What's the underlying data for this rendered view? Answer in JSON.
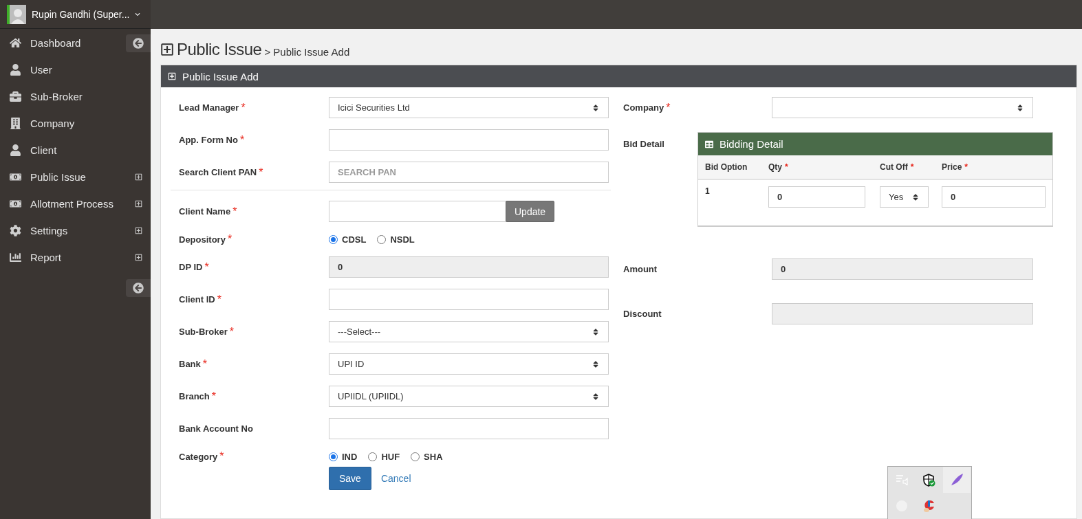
{
  "user": {
    "name": "Rupin Gandhi (Super..."
  },
  "sidebar": {
    "items": [
      {
        "label": "Dashboard",
        "expandable": false
      },
      {
        "label": "User",
        "expandable": false
      },
      {
        "label": "Sub-Broker",
        "expandable": false
      },
      {
        "label": "Company",
        "expandable": false
      },
      {
        "label": "Client",
        "expandable": false
      },
      {
        "label": "Public Issue",
        "expandable": true
      },
      {
        "label": "Allotment Process",
        "expandable": true
      },
      {
        "label": "Settings",
        "expandable": true
      },
      {
        "label": "Report",
        "expandable": true
      }
    ]
  },
  "page": {
    "title": "Public Issue",
    "breadcrumb": "> Public Issue Add"
  },
  "panel": {
    "title": "Public Issue Add"
  },
  "left_fields": [
    {
      "kind": "select",
      "label": "Lead Manager",
      "required_mark": "*",
      "value": "Icici Securities Ltd"
    },
    {
      "kind": "input",
      "label": "App. Form No",
      "required_mark": "*"
    },
    {
      "kind": "input",
      "label": "Search Client PAN",
      "required_mark": "*",
      "placeholder": "SEARCH PAN"
    },
    {
      "kind": "divider"
    },
    {
      "kind": "input_button",
      "label": "Client Name",
      "required_mark": "*",
      "button": "Update"
    },
    {
      "kind": "radio",
      "label": "Depository",
      "required_mark": "*",
      "options": [
        {
          "label": "CDSL",
          "selected": true
        },
        {
          "label": "NSDL",
          "selected": false
        }
      ]
    },
    {
      "kind": "readonly",
      "label": "DP ID",
      "required_mark": "*",
      "value": "0"
    },
    {
      "kind": "input",
      "label": "Client ID",
      "required_mark": "*"
    },
    {
      "kind": "select",
      "label": "Sub-Broker",
      "required_mark": "*",
      "value": "---Select---"
    },
    {
      "kind": "select",
      "label": "Bank",
      "required_mark": "*",
      "value": "UPI ID"
    },
    {
      "kind": "select",
      "label": "Branch",
      "required_mark": "*",
      "value": "UPIIDL (UPIIDL)"
    },
    {
      "kind": "input",
      "label": "Bank Account No"
    },
    {
      "kind": "radio",
      "label": "Category",
      "required_mark": "*",
      "options": [
        {
          "label": "IND",
          "selected": true
        },
        {
          "label": "HUF",
          "selected": false
        },
        {
          "label": "SHA",
          "selected": false
        }
      ]
    }
  ],
  "actions": {
    "save": "Save",
    "cancel": "Cancel"
  },
  "company": {
    "label": "Company",
    "required_mark": "*"
  },
  "bid_detail": {
    "label": "Bid Detail",
    "title": "Bidding Detail",
    "columns": [
      {
        "label": "Bid Option"
      },
      {
        "label": "Qty",
        "required_mark": "*"
      },
      {
        "label": "Cut Off",
        "required_mark": "*"
      },
      {
        "label": "Price",
        "required_mark": "*"
      }
    ],
    "rows": [
      {
        "bid_option": "1",
        "qty": "0",
        "cut_off": "Yes",
        "price": "0"
      }
    ]
  },
  "amount": {
    "label": "Amount",
    "value": "0"
  },
  "discount": {
    "label": "Discount"
  }
}
